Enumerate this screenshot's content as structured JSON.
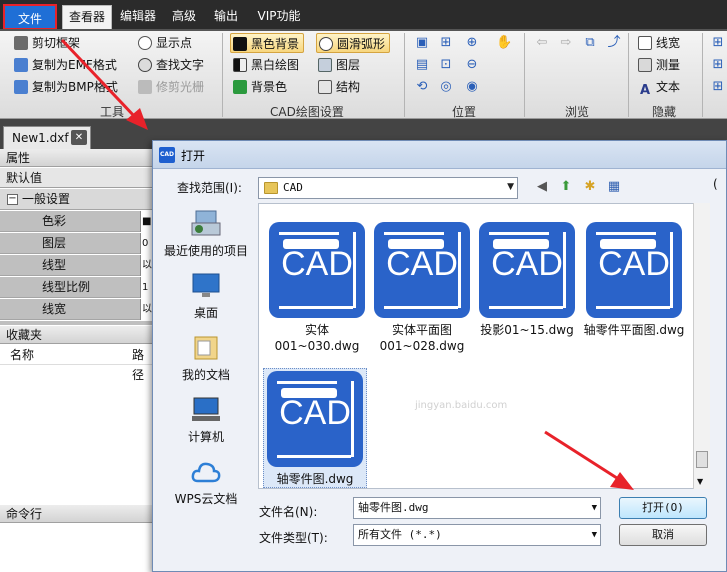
{
  "menubar": {
    "items": [
      "文件",
      "查看器",
      "编辑器",
      "高级",
      "输出",
      "VIP功能"
    ]
  },
  "ribbon": {
    "tools_group": {
      "label": "工具",
      "items": [
        "剪切框架",
        "复制为EMF格式",
        "复制为BMP格式",
        "显示点",
        "查找文字",
        "修剪光栅"
      ]
    },
    "cad_settings_group": {
      "label": "CAD绘图设置",
      "items": [
        "黑色背景",
        "圆滑弧形",
        "黑白绘图",
        "图层",
        "背景色",
        "结构"
      ]
    },
    "position_group": {
      "label": "位置"
    },
    "browse_group": {
      "label": "浏览"
    },
    "hide_group": {
      "label": "隐藏",
      "items": [
        "线宽",
        "测量",
        "文本"
      ]
    }
  },
  "document_tab": {
    "label": "New1.dxf",
    "close": "✕"
  },
  "properties_panel": {
    "title": "属性",
    "default_label": "默认值",
    "section": "一般设置",
    "expander": "−",
    "rows": [
      {
        "label": "色彩",
        "value": "■"
      },
      {
        "label": "图层",
        "value": "0"
      },
      {
        "label": "线型",
        "value": "以"
      },
      {
        "label": "线型比例",
        "value": "1"
      },
      {
        "label": "线宽",
        "value": "以"
      }
    ]
  },
  "favorites_panel": {
    "title": "收藏夹",
    "col_name": "名称",
    "col_path": "路径"
  },
  "command_panel": {
    "title": "命令行"
  },
  "dialog": {
    "title": "打开",
    "icon_text": "CAD",
    "look_in_label": "查找范围(I):",
    "look_in_value": "CAD",
    "places": [
      "最近使用的项目",
      "桌面",
      "我的文档",
      "计算机",
      "WPS云文档"
    ],
    "files": [
      {
        "icon_text": "CAD",
        "name_line1": "实体",
        "name_line2": "001~030.dwg"
      },
      {
        "icon_text": "CAD",
        "name_line1": "实体平面图",
        "name_line2": "001~028.dwg"
      },
      {
        "icon_text": "CAD",
        "name_line1": "投影01~15.dwg",
        "name_line2": ""
      },
      {
        "icon_text": "CAD",
        "name_line1": "轴零件平面图.dwg",
        "name_line2": ""
      },
      {
        "icon_text": "CAD",
        "name_line1": "轴零件图.dwg",
        "name_line2": ""
      }
    ],
    "filename_label": "文件名(N):",
    "filename_value": "轴零件图.dwg",
    "filetype_label": "文件类型(T):",
    "filetype_value": "所有文件 (*.*)",
    "open_button": "打开(O)",
    "cancel_button": "取消",
    "preview_fragment": "("
  },
  "watermark": "jingyan.baidu.com"
}
